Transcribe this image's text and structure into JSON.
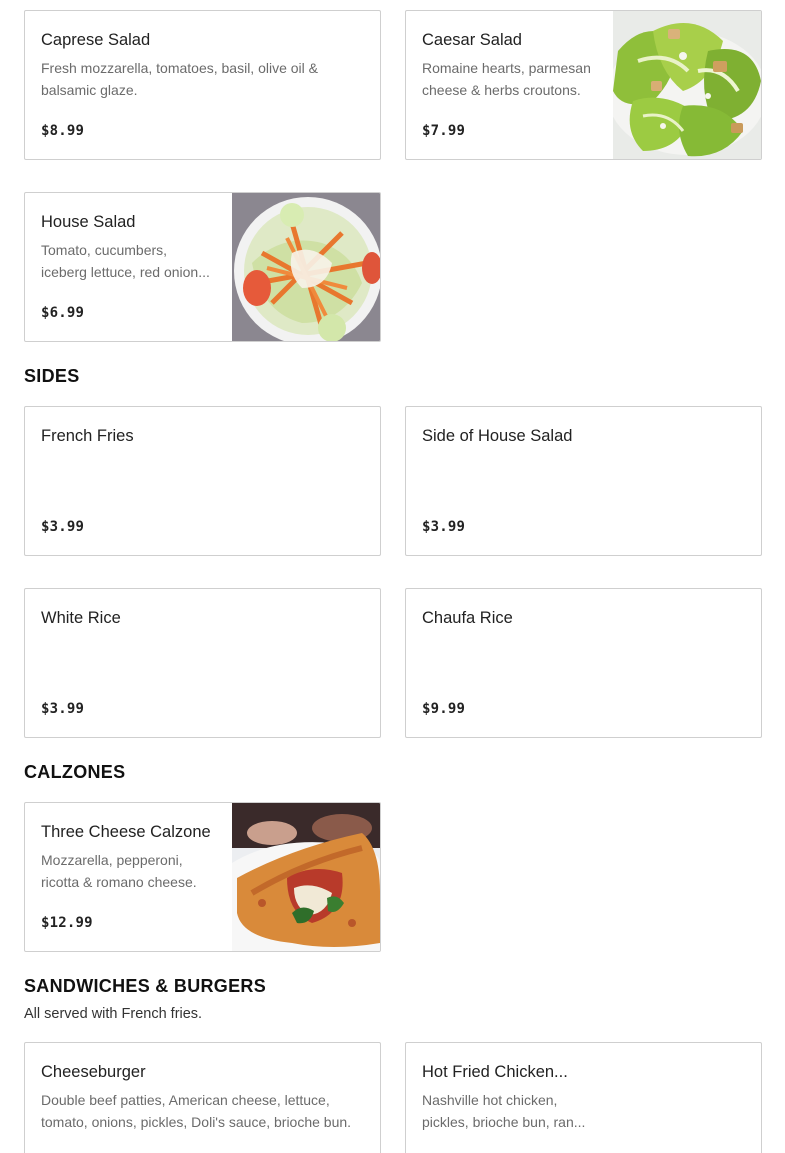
{
  "salads": {
    "items": [
      {
        "name": "Caprese Salad",
        "description": "Fresh mozzarella, tomatoes, basil, olive oil & balsamic glaze.",
        "price": "$8.99"
      },
      {
        "name": "Caesar Salad",
        "description": "Romaine hearts, parmesan cheese & herbs croutons.",
        "price": "$7.99",
        "image": "caesar-salad-photo"
      },
      {
        "name": "House Salad",
        "description": "Tomato, cucumbers, iceberg lettuce, red onion...",
        "price": "$6.99",
        "image": "house-salad-photo"
      }
    ]
  },
  "sides": {
    "title": "SIDES",
    "items": [
      {
        "name": "French Fries",
        "price": "$3.99"
      },
      {
        "name": "Side of House Salad",
        "price": "$3.99"
      },
      {
        "name": "White Rice",
        "price": "$3.99"
      },
      {
        "name": "Chaufa Rice",
        "price": "$9.99"
      }
    ]
  },
  "calzones": {
    "title": "CALZONES",
    "items": [
      {
        "name": "Three Cheese Calzone",
        "description": "Mozzarella, pepperoni, ricotta & romano cheese.",
        "price": "$12.99",
        "image": "calzone-photo"
      }
    ]
  },
  "sandwiches": {
    "title": "SANDWICHES & BURGERS",
    "subtitle": "All served with French fries.",
    "items": [
      {
        "name": "Cheeseburger",
        "description": "Double beef patties, American cheese, lettuce, tomato, onions, pickles, Doli's sauce, brioche bun."
      },
      {
        "name": "Hot Fried Chicken...",
        "description": "Nashville hot chicken, pickles, brioche bun, ran..."
      }
    ]
  }
}
